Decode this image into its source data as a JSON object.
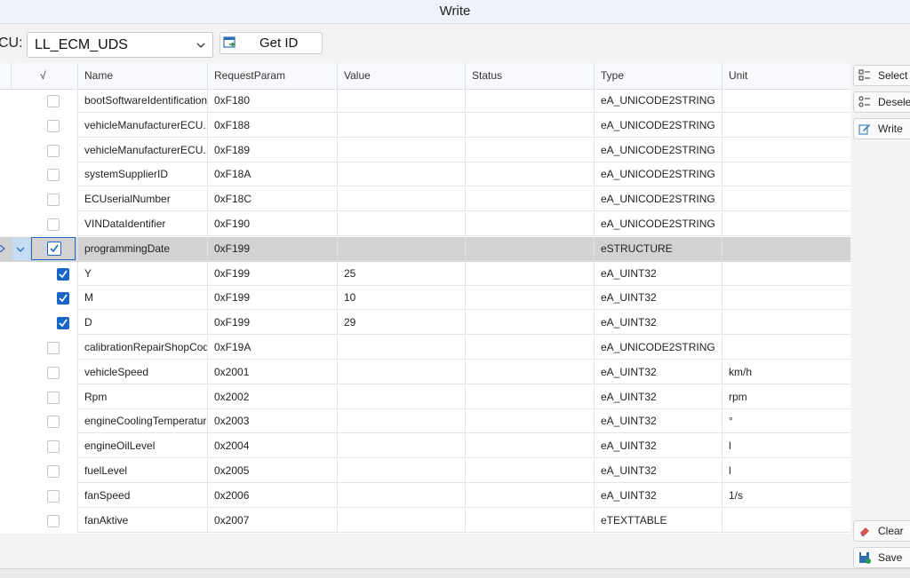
{
  "window": {
    "title": "Write"
  },
  "toolbar": {
    "ecu_label": "CU:",
    "ecu_value": "LL_ECM_UDS",
    "get_id_label": "Get ID"
  },
  "table": {
    "columns": [
      "√",
      "Name",
      "RequestParam",
      "Value",
      "Status",
      "Type",
      "Unit"
    ],
    "rows": [
      {
        "name": "bootSoftwareIdentification",
        "param": "0xF180",
        "value": "",
        "status": "",
        "type": "eA_UNICODE2STRING",
        "unit": "",
        "checked": false
      },
      {
        "name": "vehicleManufacturerECU...",
        "param": "0xF188",
        "value": "",
        "status": "",
        "type": "eA_UNICODE2STRING",
        "unit": "",
        "checked": false
      },
      {
        "name": "vehicleManufacturerECU...",
        "param": "0xF189",
        "value": "",
        "status": "",
        "type": "eA_UNICODE2STRING",
        "unit": "",
        "checked": false
      },
      {
        "name": "systemSupplierID",
        "param": "0xF18A",
        "value": "",
        "status": "",
        "type": "eA_UNICODE2STRING",
        "unit": "",
        "checked": false
      },
      {
        "name": "ECUserialNumber",
        "param": "0xF18C",
        "value": "",
        "status": "",
        "type": "eA_UNICODE2STRING",
        "unit": "",
        "checked": false
      },
      {
        "name": "VINDataIdentifier",
        "param": "0xF190",
        "value": "",
        "status": "",
        "type": "eA_UNICODE2STRING",
        "unit": "",
        "checked": false
      },
      {
        "name": "programmingDate",
        "param": "0xF199",
        "value": "",
        "status": "",
        "type": "eSTRUCTURE",
        "unit": "",
        "checked": true,
        "selected": true,
        "expanded": true
      },
      {
        "name": "Y",
        "param": "0xF199",
        "value": "25",
        "status": "",
        "type": "eA_UINT32",
        "unit": "",
        "checked": true,
        "child": true
      },
      {
        "name": "M",
        "param": "0xF199",
        "value": "10",
        "status": "",
        "type": "eA_UINT32",
        "unit": "",
        "checked": true,
        "child": true
      },
      {
        "name": "D",
        "param": "0xF199",
        "value": "29",
        "status": "",
        "type": "eA_UINT32",
        "unit": "",
        "checked": true,
        "child": true
      },
      {
        "name": "calibrationRepairShopCod...",
        "param": "0xF19A",
        "value": "",
        "status": "",
        "type": "eA_UNICODE2STRING",
        "unit": "",
        "checked": false
      },
      {
        "name": "vehicleSpeed",
        "param": "0x2001",
        "value": "",
        "status": "",
        "type": "eA_UINT32",
        "unit": "km/h",
        "checked": false
      },
      {
        "name": "Rpm",
        "param": "0x2002",
        "value": "",
        "status": "",
        "type": "eA_UINT32",
        "unit": "rpm",
        "checked": false
      },
      {
        "name": "engineCoolingTemperature",
        "param": "0x2003",
        "value": "",
        "status": "",
        "type": "eA_UINT32",
        "unit": "°",
        "checked": false
      },
      {
        "name": "engineOilLevel",
        "param": "0x2004",
        "value": "",
        "status": "",
        "type": "eA_UINT32",
        "unit": "l",
        "checked": false
      },
      {
        "name": "fuelLevel",
        "param": "0x2005",
        "value": "",
        "status": "",
        "type": "eA_UINT32",
        "unit": "l",
        "checked": false
      },
      {
        "name": "fanSpeed",
        "param": "0x2006",
        "value": "",
        "status": "",
        "type": "eA_UINT32",
        "unit": "1/s",
        "checked": false
      },
      {
        "name": "fanAktive",
        "param": "0x2007",
        "value": "",
        "status": "",
        "type": "eTEXTTABLE",
        "unit": "",
        "checked": false
      }
    ]
  },
  "sidebar": {
    "select_all": "Select A",
    "deselect": "Deselect",
    "write": "Write",
    "clear": "Clear",
    "save": "Save"
  },
  "colors": {
    "accent": "#1a66c8",
    "selected_row": "#d2d2d2",
    "expander": "#c4dcf4"
  }
}
